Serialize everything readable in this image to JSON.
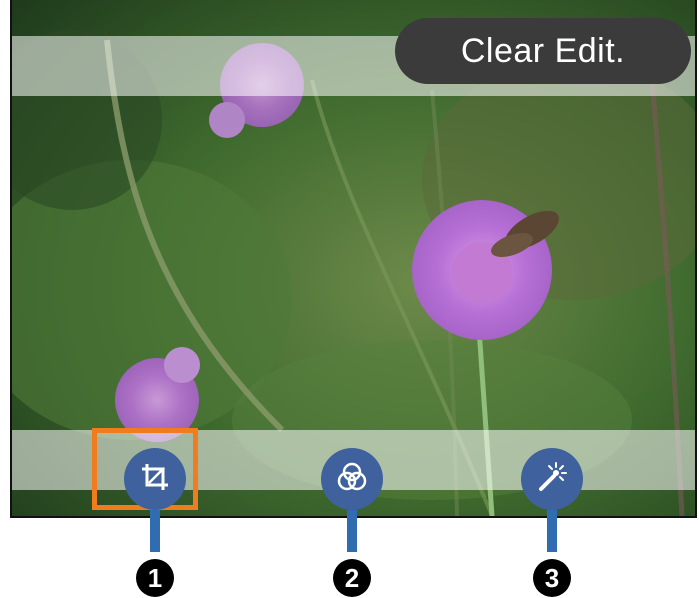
{
  "header": {
    "clear_edit_label": "Clear Edit."
  },
  "tools": [
    {
      "name": "crop",
      "icon": "crop-icon",
      "selected": true
    },
    {
      "name": "color-filter",
      "icon": "color-filter-icon",
      "selected": false
    },
    {
      "name": "auto-enhance",
      "icon": "magic-wand-icon",
      "selected": false
    }
  ],
  "callouts": [
    "1",
    "2",
    "3"
  ],
  "colors": {
    "tool_button": "#3f629e",
    "selection_frame": "#f07c1e",
    "callout_line": "#2f6db0",
    "clear_button": "#3b3b3b"
  }
}
